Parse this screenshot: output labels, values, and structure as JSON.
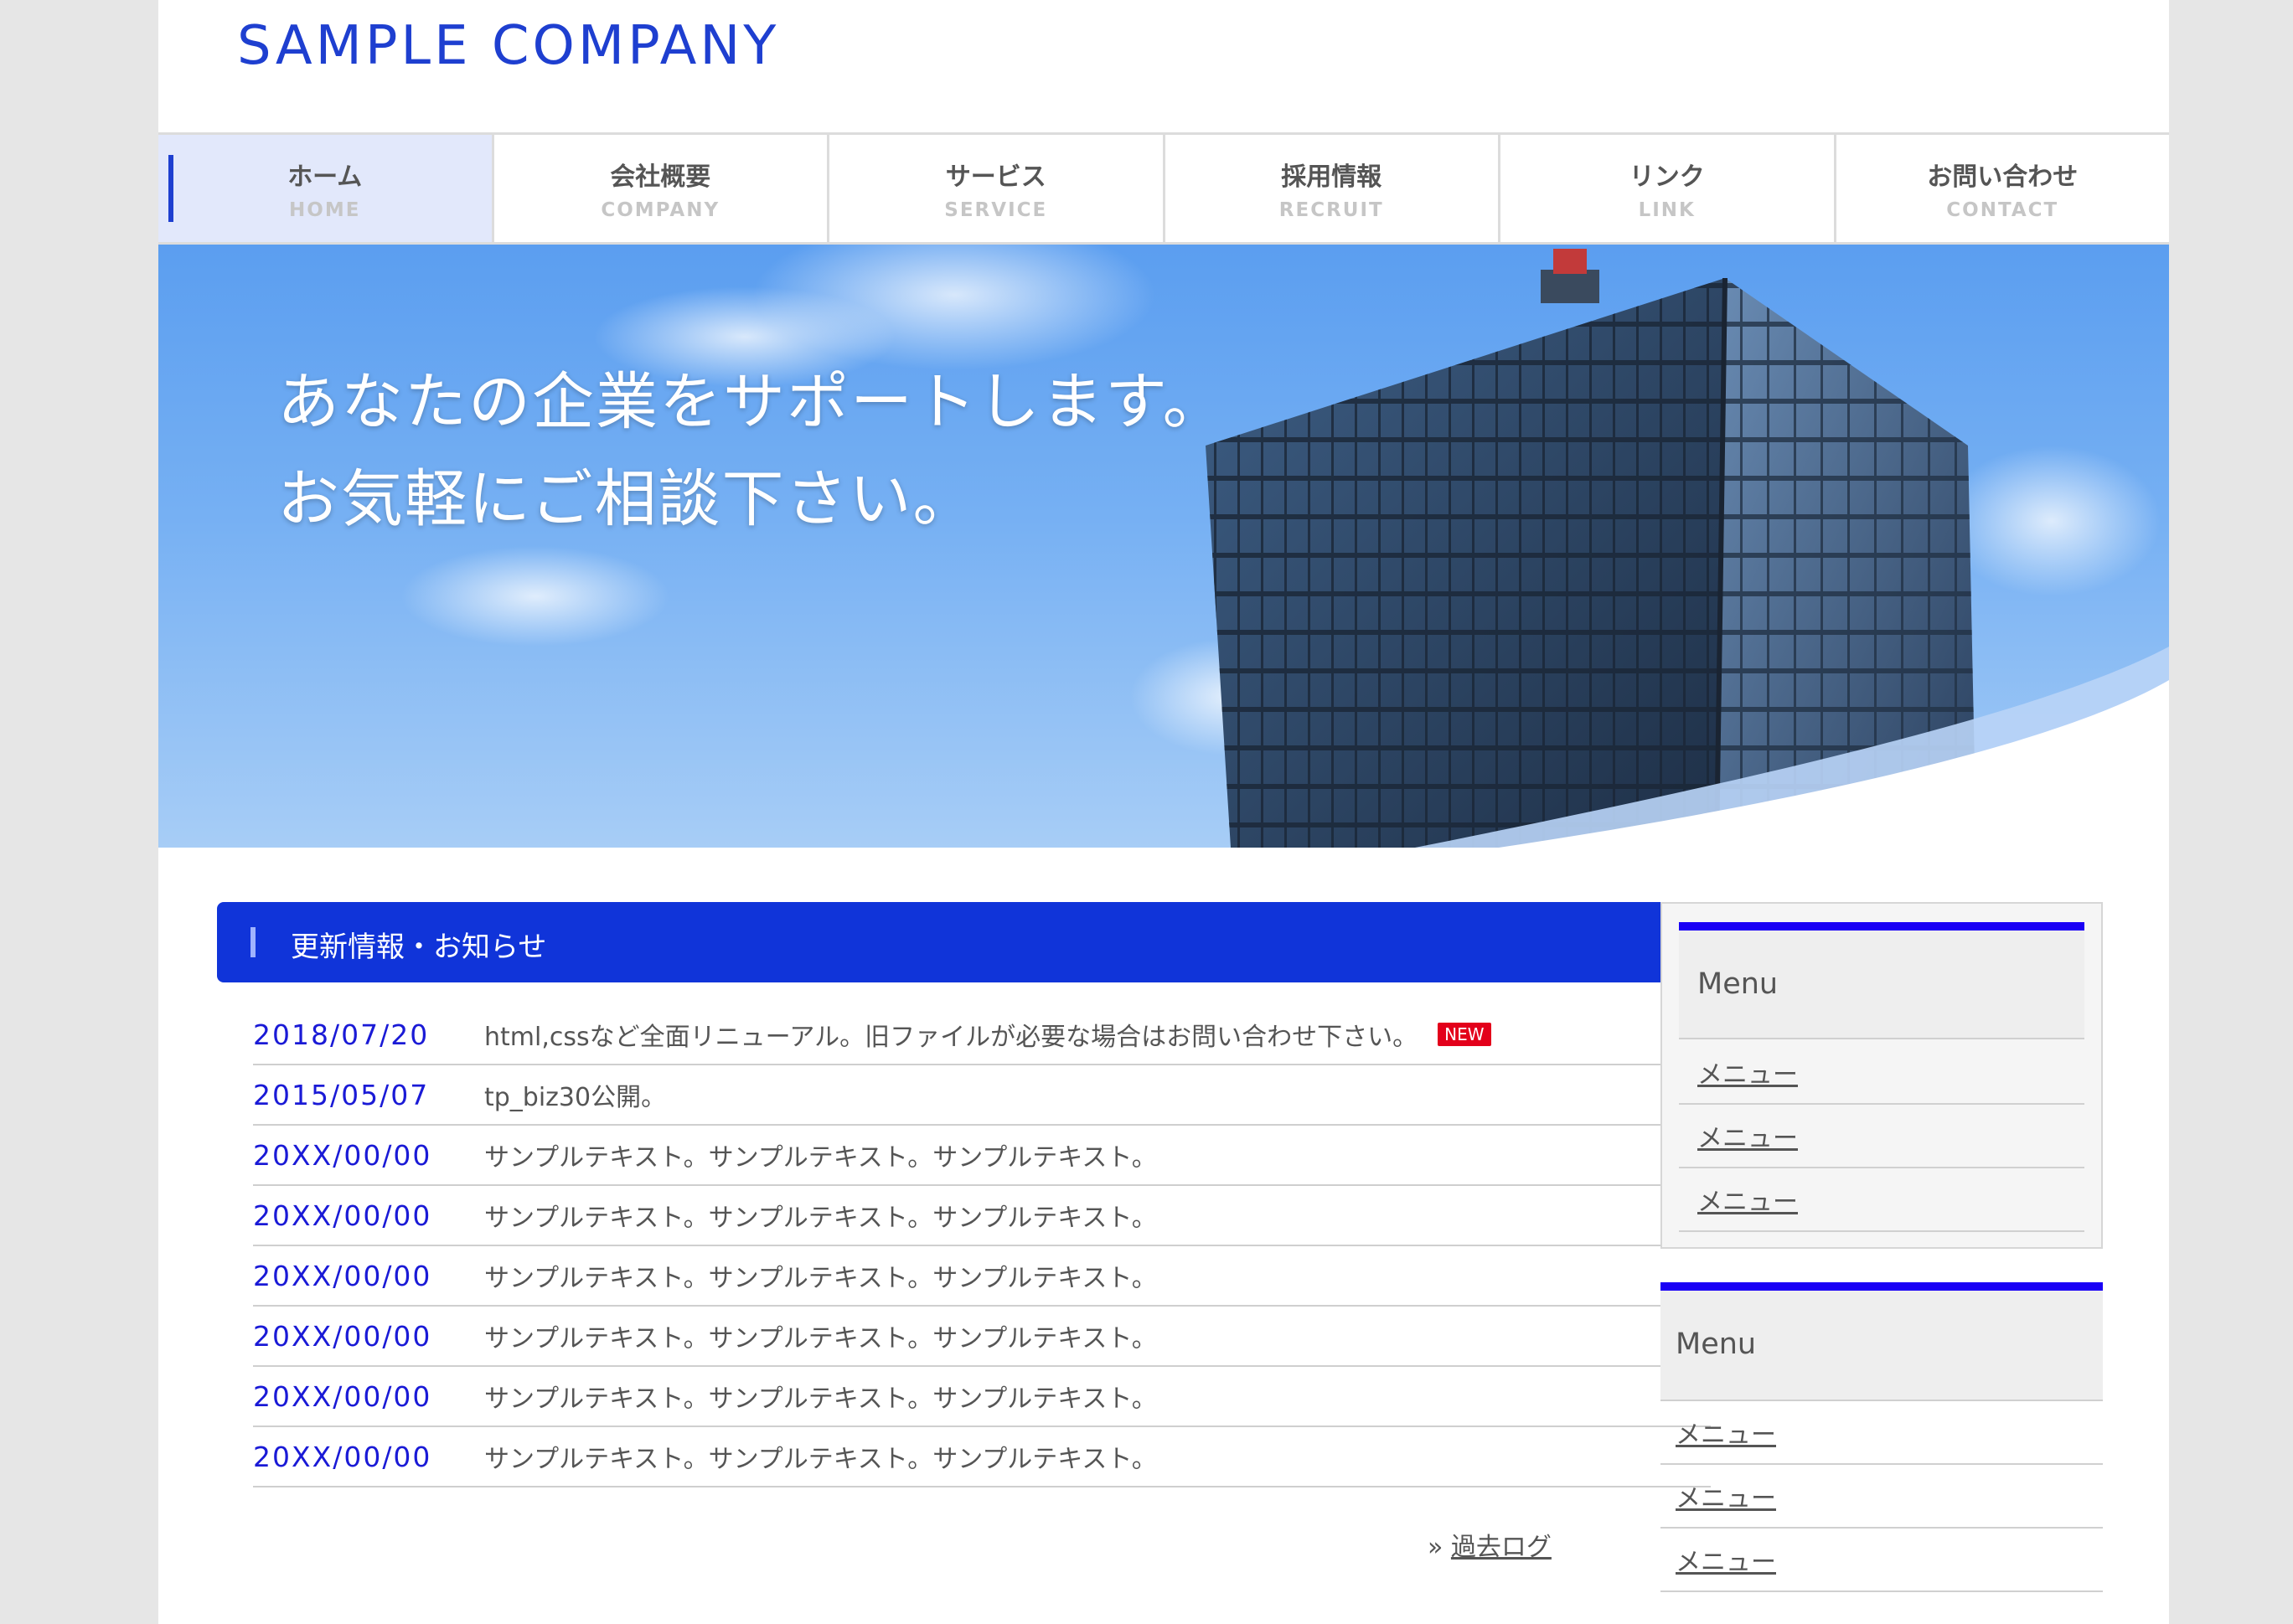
{
  "header": {
    "logo": "SAMPLE COMPANY"
  },
  "nav": [
    {
      "jp": "ホーム",
      "en": "HOME",
      "active": true
    },
    {
      "jp": "会社概要",
      "en": "COMPANY"
    },
    {
      "jp": "サービス",
      "en": "SERVICE"
    },
    {
      "jp": "採用情報",
      "en": "RECRUIT"
    },
    {
      "jp": "リンク",
      "en": "LINK"
    },
    {
      "jp": "お問い合わせ",
      "en": "CONTACT"
    }
  ],
  "hero": {
    "line1": "あなたの企業をサポートします。",
    "line2": "お気軽にご相談下さい。"
  },
  "news": {
    "heading": "更新情報・お知らせ",
    "items": [
      {
        "date": "2018/07/20",
        "text": "html,cssなど全面リニューアル。旧ファイルが必要な場合はお問い合わせ下さい。",
        "badge": "NEW"
      },
      {
        "date": "2015/05/07",
        "text": "tp_biz30公開。"
      },
      {
        "date": "20XX/00/00",
        "text": "サンプルテキスト。サンプルテキスト。サンプルテキスト。"
      },
      {
        "date": "20XX/00/00",
        "text": "サンプルテキスト。サンプルテキスト。サンプルテキスト。"
      },
      {
        "date": "20XX/00/00",
        "text": "サンプルテキスト。サンプルテキスト。サンプルテキスト。"
      },
      {
        "date": "20XX/00/00",
        "text": "サンプルテキスト。サンプルテキスト。サンプルテキスト。"
      },
      {
        "date": "20XX/00/00",
        "text": "サンプルテキスト。サンプルテキスト。サンプルテキスト。"
      },
      {
        "date": "20XX/00/00",
        "text": "サンプルテキスト。サンプルテキスト。サンプルテキスト。"
      }
    ],
    "past_log_prefix": "»",
    "past_log": "過去ログ"
  },
  "sidebar": {
    "box1": {
      "title": "Menu",
      "items": [
        "メニュー",
        "メニュー",
        "メニュー"
      ]
    },
    "box2": {
      "title": "Menu",
      "items": [
        "メニュー",
        "メニュー",
        "メニュー"
      ]
    }
  },
  "colors": {
    "brand": "#1e3fd0",
    "heading_bg": "#1034d9",
    "date": "#1a1ad6",
    "sidebar_accent": "#1a00f5",
    "badge": "#e3001b"
  }
}
